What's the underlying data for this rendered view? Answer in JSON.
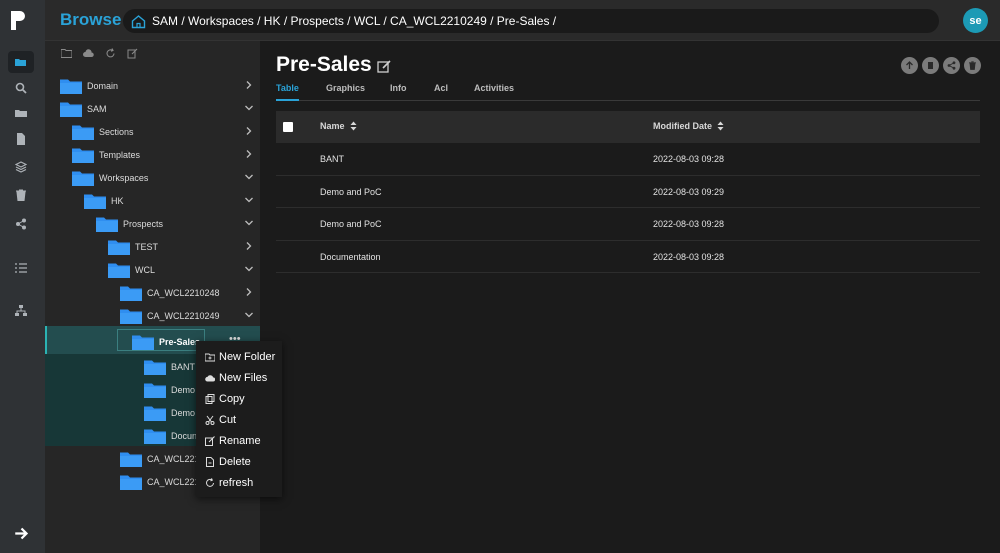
{
  "header": {
    "title": "Browse",
    "breadcrumb": "SAM / Workspaces / HK / Prospects / WCL / CA_WCL2210249 / Pre-Sales /",
    "avatar_initials": "se"
  },
  "rail": {
    "icons": [
      "folder-open-icon",
      "search-icon",
      "folders-icon",
      "document-icon",
      "layers-icon",
      "trash-icon",
      "share-icon",
      "checklist-icon",
      "org-chart-icon"
    ],
    "bottom_icon": "arrow-right-icon"
  },
  "tree": {
    "toolbar": [
      "new-folder-icon",
      "upload-cloud-icon",
      "refresh-icon",
      "edit-icon"
    ],
    "nodes": [
      {
        "label": "Domain",
        "expanded": false
      },
      {
        "label": "SAM",
        "expanded": true
      },
      {
        "label": "Sections",
        "expanded": false
      },
      {
        "label": "Templates",
        "expanded": false
      },
      {
        "label": "Workspaces",
        "expanded": true
      },
      {
        "label": "HK",
        "expanded": true
      },
      {
        "label": "Prospects",
        "expanded": true
      },
      {
        "label": "TEST",
        "expanded": false
      },
      {
        "label": "WCL",
        "expanded": true
      },
      {
        "label": "CA_WCL2210248",
        "expanded": false
      },
      {
        "label": "CA_WCL2210249",
        "expanded": true
      },
      {
        "label": "Pre-Sales",
        "selected": true
      },
      {
        "label": "BANT"
      },
      {
        "label": "Demo"
      },
      {
        "label": "Demo"
      },
      {
        "label": "Docun"
      },
      {
        "label": "CA_WCL221("
      },
      {
        "label": "CA_WCL221("
      }
    ],
    "more_label": "•••"
  },
  "context_menu": {
    "items": [
      {
        "label": "New Folder",
        "icon": "new-folder-icon"
      },
      {
        "label": "New Files",
        "icon": "upload-cloud-icon"
      },
      {
        "label": "Copy",
        "icon": "copy-icon"
      },
      {
        "label": "Cut",
        "icon": "scissors-icon"
      },
      {
        "label": "Rename",
        "icon": "rename-icon"
      },
      {
        "label": "Delete",
        "icon": "delete-file-icon"
      },
      {
        "label": "refresh",
        "icon": "refresh-icon"
      }
    ]
  },
  "main": {
    "title": "Pre-Sales",
    "actions": [
      "upload-icon",
      "copy-icon",
      "share-icon",
      "trash-icon"
    ],
    "tabs": [
      {
        "label": "Table",
        "active": true
      },
      {
        "label": "Graphics"
      },
      {
        "label": "Info"
      },
      {
        "label": "Acl"
      },
      {
        "label": "Activities"
      }
    ],
    "table": {
      "columns": [
        "Name",
        "Modified Date"
      ],
      "rows": [
        {
          "name": "BANT",
          "modified": "2022-08-03 09:28"
        },
        {
          "name": "Demo and PoC",
          "modified": "2022-08-03 09:29"
        },
        {
          "name": "Demo and PoC",
          "modified": "2022-08-03 09:28"
        },
        {
          "name": "Documentation",
          "modified": "2022-08-03 09:28"
        }
      ]
    }
  },
  "colors": {
    "accent": "#2aa3d8",
    "folder": "#2f8ef0",
    "selection": "#234d4f"
  }
}
